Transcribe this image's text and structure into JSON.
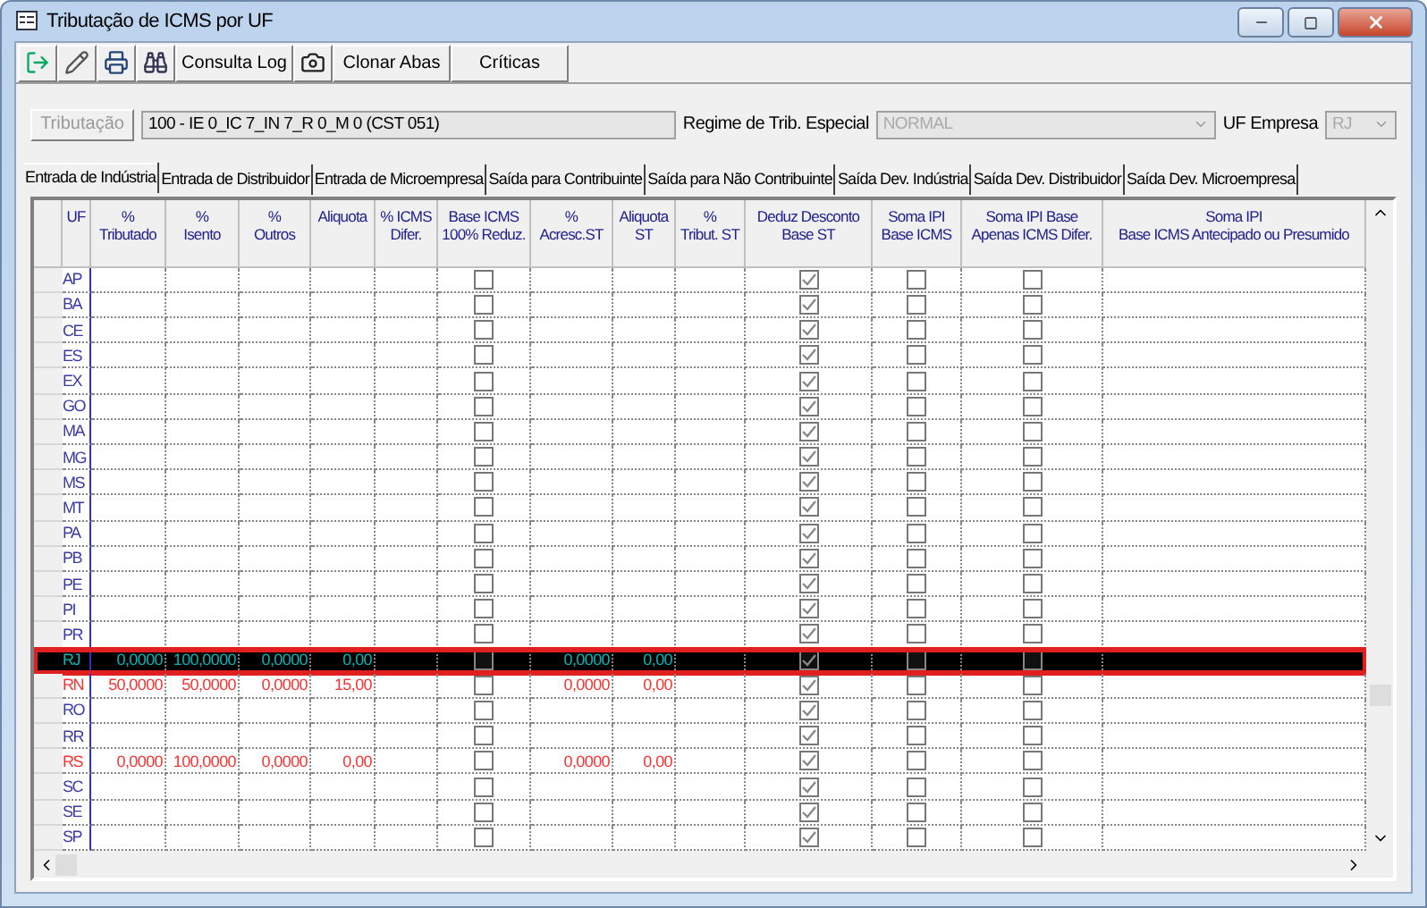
{
  "window": {
    "title": "Tributação de ICMS por UF"
  },
  "toolbar": [
    {
      "kind": "exit"
    },
    {
      "kind": "pencil"
    },
    {
      "kind": "print"
    },
    {
      "kind": "binoculars"
    },
    {
      "kind": "button",
      "label": "Consulta Log"
    },
    {
      "kind": "camera"
    },
    {
      "kind": "button",
      "label": "Clonar Abas"
    },
    {
      "kind": "button",
      "label": "Críticas"
    }
  ],
  "tributacao": {
    "button": "Tributação",
    "disabled": true,
    "value": "100 - IE 0_IC 7_IN 7_R 0_M 0 (CST 051)"
  },
  "regime": {
    "label": "Regime de Trib. Especial",
    "value": "NORMAL"
  },
  "uf_empresa": {
    "label": "UF Empresa",
    "value": "RJ"
  },
  "tabs": [
    {
      "label": "Entrada de Indústria",
      "selected": true
    },
    {
      "label": "Entrada de Distribuidor",
      "selected": false
    },
    {
      "label": "Entrada de Microempresa",
      "selected": false
    },
    {
      "label": "Saída para Contribuinte",
      "selected": false
    },
    {
      "label": "Saída para Não Contribuinte",
      "selected": false
    },
    {
      "label": "Saída Dev. Indústria",
      "selected": false
    },
    {
      "label": "Saída Dev. Distribuidor",
      "selected": false
    },
    {
      "label": "Saída Dev. Microempresa",
      "selected": false
    }
  ],
  "table": {
    "columns": [
      {
        "label": "UF",
        "kind": "text"
      },
      {
        "label": "%\nTributado",
        "kind": "num"
      },
      {
        "label": "%\nIsento",
        "kind": "num"
      },
      {
        "label": "%\nOutros",
        "kind": "num"
      },
      {
        "label": "Aliquota",
        "kind": "num"
      },
      {
        "label": "% ICMS\nDifer.",
        "kind": "num"
      },
      {
        "label": "Base ICMS\n100% Reduz.",
        "kind": "check"
      },
      {
        "label": "%\nAcresc.ST",
        "kind": "num"
      },
      {
        "label": "Aliquota\nST",
        "kind": "num"
      },
      {
        "label": "%\nTribut. ST",
        "kind": "num"
      },
      {
        "label": "Deduz Desconto\nBase ST",
        "kind": "check"
      },
      {
        "label": "Soma IPI\nBase ICMS",
        "kind": "check"
      },
      {
        "label": "Soma IPI Base\nApenas ICMS Difer.",
        "kind": "check"
      },
      {
        "label": "Soma IPI\nBase ICMS Antecipado ou Presumido",
        "kind": "num"
      }
    ],
    "rows": [
      {
        "selected": false,
        "kind": "default",
        "cells": [
          {
            "text": "AP"
          },
          {},
          {},
          {},
          {},
          {},
          {
            "checked": false
          },
          {},
          {},
          {},
          {
            "checked": true
          },
          {
            "checked": false
          },
          {
            "checked": false
          },
          {}
        ]
      },
      {
        "selected": false,
        "kind": "default",
        "cells": [
          {
            "text": "BA"
          },
          {},
          {},
          {},
          {},
          {},
          {
            "checked": false
          },
          {},
          {},
          {},
          {
            "checked": true
          },
          {
            "checked": false
          },
          {
            "checked": false
          },
          {}
        ]
      },
      {
        "selected": false,
        "kind": "default",
        "cells": [
          {
            "text": "CE"
          },
          {},
          {},
          {},
          {},
          {},
          {
            "checked": false
          },
          {},
          {},
          {},
          {
            "checked": true
          },
          {
            "checked": false
          },
          {
            "checked": false
          },
          {}
        ]
      },
      {
        "selected": false,
        "kind": "default",
        "cells": [
          {
            "text": "ES"
          },
          {},
          {},
          {},
          {},
          {},
          {
            "checked": false
          },
          {},
          {},
          {},
          {
            "checked": true
          },
          {
            "checked": false
          },
          {
            "checked": false
          },
          {}
        ]
      },
      {
        "selected": false,
        "kind": "default",
        "cells": [
          {
            "text": "EX"
          },
          {},
          {},
          {},
          {},
          {},
          {
            "checked": false
          },
          {},
          {},
          {},
          {
            "checked": true
          },
          {
            "checked": false
          },
          {
            "checked": false
          },
          {}
        ]
      },
      {
        "selected": false,
        "kind": "default",
        "cells": [
          {
            "text": "GO"
          },
          {},
          {},
          {},
          {},
          {},
          {
            "checked": false
          },
          {},
          {},
          {},
          {
            "checked": true
          },
          {
            "checked": false
          },
          {
            "checked": false
          },
          {}
        ]
      },
      {
        "selected": false,
        "kind": "default",
        "cells": [
          {
            "text": "MA"
          },
          {},
          {},
          {},
          {},
          {},
          {
            "checked": false
          },
          {},
          {},
          {},
          {
            "checked": true
          },
          {
            "checked": false
          },
          {
            "checked": false
          },
          {}
        ]
      },
      {
        "selected": false,
        "kind": "default",
        "cells": [
          {
            "text": "MG"
          },
          {},
          {},
          {},
          {},
          {},
          {
            "checked": false
          },
          {},
          {},
          {},
          {
            "checked": true
          },
          {
            "checked": false
          },
          {
            "checked": false
          },
          {}
        ]
      },
      {
        "selected": false,
        "kind": "default",
        "cells": [
          {
            "text": "MS"
          },
          {},
          {},
          {},
          {},
          {},
          {
            "checked": false
          },
          {},
          {},
          {},
          {
            "checked": true
          },
          {
            "checked": false
          },
          {
            "checked": false
          },
          {}
        ]
      },
      {
        "selected": false,
        "kind": "default",
        "cells": [
          {
            "text": "MT"
          },
          {},
          {},
          {},
          {},
          {},
          {
            "checked": false
          },
          {},
          {},
          {},
          {
            "checked": true
          },
          {
            "checked": false
          },
          {
            "checked": false
          },
          {}
        ]
      },
      {
        "selected": false,
        "kind": "default",
        "cells": [
          {
            "text": "PA"
          },
          {},
          {},
          {},
          {},
          {},
          {
            "checked": false
          },
          {},
          {},
          {},
          {
            "checked": true
          },
          {
            "checked": false
          },
          {
            "checked": false
          },
          {}
        ]
      },
      {
        "selected": false,
        "kind": "default",
        "cells": [
          {
            "text": "PB"
          },
          {},
          {},
          {},
          {},
          {},
          {
            "checked": false
          },
          {},
          {},
          {},
          {
            "checked": true
          },
          {
            "checked": false
          },
          {
            "checked": false
          },
          {}
        ]
      },
      {
        "selected": false,
        "kind": "default",
        "cells": [
          {
            "text": "PE"
          },
          {},
          {},
          {},
          {},
          {},
          {
            "checked": false
          },
          {},
          {},
          {},
          {
            "checked": true
          },
          {
            "checked": false
          },
          {
            "checked": false
          },
          {}
        ]
      },
      {
        "selected": false,
        "kind": "default",
        "cells": [
          {
            "text": "PI"
          },
          {},
          {},
          {},
          {},
          {},
          {
            "checked": false
          },
          {},
          {},
          {},
          {
            "checked": true
          },
          {
            "checked": false
          },
          {
            "checked": false
          },
          {}
        ]
      },
      {
        "selected": false,
        "kind": "default",
        "cells": [
          {
            "text": "PR"
          },
          {},
          {},
          {},
          {},
          {},
          {
            "checked": false
          },
          {},
          {},
          {},
          {
            "checked": true
          },
          {
            "checked": false
          },
          {
            "checked": false
          },
          {}
        ]
      },
      {
        "selected": true,
        "cells": [
          {
            "text": "RJ"
          },
          {
            "text": "0,0000"
          },
          {
            "text": "100,0000"
          },
          {
            "text": "0,0000"
          },
          {
            "text": "0,00"
          },
          {},
          {
            "checked": false
          },
          {
            "text": "0,0000"
          },
          {
            "text": "0,00"
          },
          {},
          {
            "checked": true
          },
          {
            "checked": false
          },
          {
            "checked": false
          },
          {}
        ]
      },
      {
        "selected": false,
        "kind": "configured",
        "cells": [
          {
            "text": "RN"
          },
          {
            "text": "50,0000"
          },
          {
            "text": "50,0000"
          },
          {
            "text": "0,0000"
          },
          {
            "text": "15,00"
          },
          {},
          {
            "checked": false
          },
          {
            "text": "0,0000"
          },
          {
            "text": "0,00"
          },
          {},
          {
            "checked": true
          },
          {
            "checked": false
          },
          {
            "checked": false
          },
          {}
        ]
      },
      {
        "selected": false,
        "kind": "default",
        "cells": [
          {
            "text": "RO"
          },
          {},
          {},
          {},
          {},
          {},
          {
            "checked": false
          },
          {},
          {},
          {},
          {
            "checked": true
          },
          {
            "checked": false
          },
          {
            "checked": false
          },
          {}
        ]
      },
      {
        "selected": false,
        "kind": "default",
        "cells": [
          {
            "text": "RR"
          },
          {},
          {},
          {},
          {},
          {},
          {
            "checked": false
          },
          {},
          {},
          {},
          {
            "checked": true
          },
          {
            "checked": false
          },
          {
            "checked": false
          },
          {}
        ]
      },
      {
        "selected": false,
        "kind": "configured",
        "cells": [
          {
            "text": "RS"
          },
          {
            "text": "0,0000"
          },
          {
            "text": "100,0000"
          },
          {
            "text": "0,0000"
          },
          {
            "text": "0,00"
          },
          {},
          {
            "checked": false
          },
          {
            "text": "0,0000"
          },
          {
            "text": "0,00"
          },
          {},
          {
            "checked": true
          },
          {
            "checked": false
          },
          {
            "checked": false
          },
          {}
        ]
      },
      {
        "selected": false,
        "kind": "default",
        "cells": [
          {
            "text": "SC"
          },
          {},
          {},
          {},
          {},
          {},
          {
            "checked": false
          },
          {},
          {},
          {},
          {
            "checked": true
          },
          {
            "checked": false
          },
          {
            "checked": false
          },
          {}
        ]
      },
      {
        "selected": false,
        "kind": "default",
        "cells": [
          {
            "text": "SE"
          },
          {},
          {},
          {},
          {},
          {},
          {
            "checked": false
          },
          {},
          {},
          {},
          {
            "checked": true
          },
          {
            "checked": false
          },
          {
            "checked": false
          },
          {}
        ]
      },
      {
        "selected": false,
        "kind": "default",
        "cells": [
          {
            "text": "SP"
          },
          {},
          {},
          {},
          {},
          {},
          {
            "checked": false
          },
          {},
          {},
          {},
          {
            "checked": true
          },
          {
            "checked": false
          },
          {
            "checked": false
          },
          {}
        ]
      }
    ]
  }
}
